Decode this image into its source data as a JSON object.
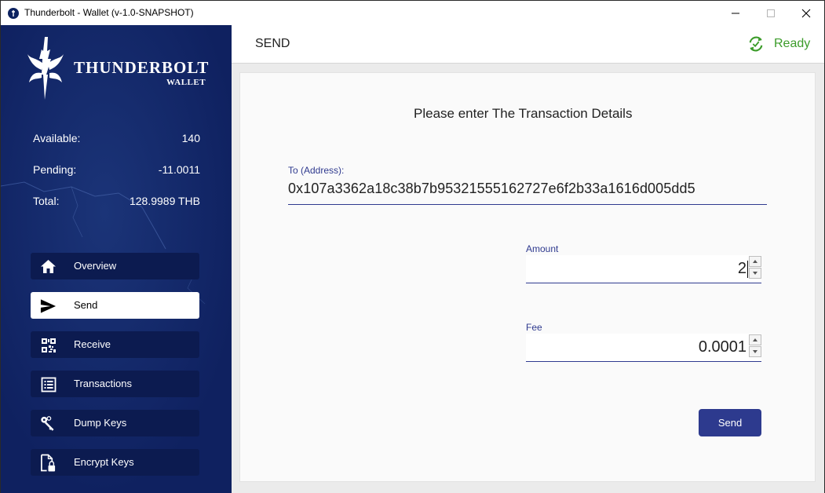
{
  "window": {
    "title": "Thunderbolt - Wallet (v-1.0-SNAPSHOT)",
    "minimize_icon": "minimize-icon",
    "maximize_icon": "maximize-icon",
    "close_icon": "close-icon"
  },
  "sidebar": {
    "logo": {
      "name": "THUNDERBOLT",
      "sub": "WALLET"
    },
    "balances": [
      {
        "label": "Available:",
        "value": "140"
      },
      {
        "label": "Pending:",
        "value": "-11.0011"
      },
      {
        "label": "Total:",
        "value": "128.9989 THB"
      }
    ],
    "items": [
      {
        "label": "Overview",
        "icon": "home-icon",
        "active": false
      },
      {
        "label": "Send",
        "icon": "send-icon",
        "active": true
      },
      {
        "label": "Receive",
        "icon": "qr-code-icon",
        "active": false
      },
      {
        "label": "Transactions",
        "icon": "list-icon",
        "active": false
      },
      {
        "label": "Dump Keys",
        "icon": "keys-icon",
        "active": false
      },
      {
        "label": "Encrypt Keys",
        "icon": "lock-file-icon",
        "active": false
      }
    ]
  },
  "header": {
    "title": "SEND",
    "status_text": "Ready",
    "status_icon": "sync-icon"
  },
  "form": {
    "heading": "Please enter The Transaction Details",
    "address_label": "To (Address):",
    "address_value": "0x107a3362a18c38b7b95321555162727e6f2b33a1616d005dd5",
    "amount_label": "Amount",
    "amount_value": "2",
    "fee_label": "Fee",
    "fee_value": "0.0001",
    "send_label": "Send"
  },
  "colors": {
    "sidebar_bg": "#0f2160",
    "nav_bg": "#0c1b50",
    "accent": "#2d3a8e",
    "status_green": "#3c9c2a"
  }
}
